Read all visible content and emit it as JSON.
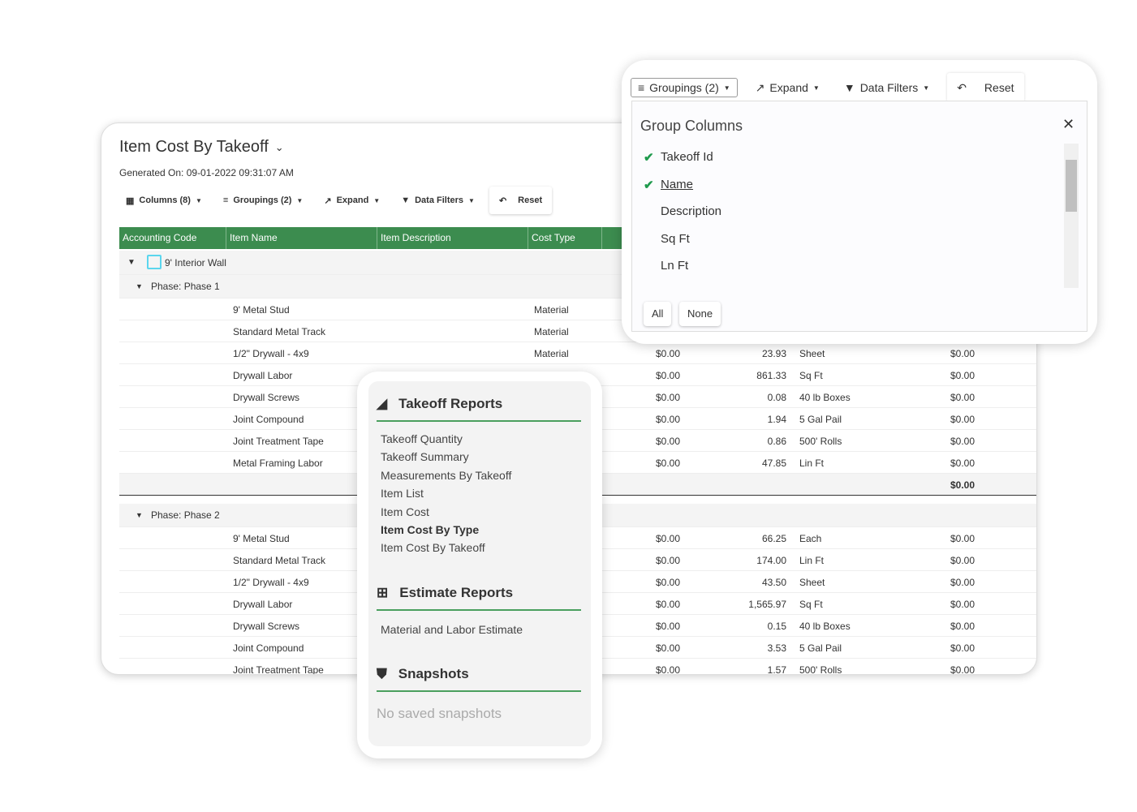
{
  "report": {
    "title": "Item Cost By Takeoff",
    "generated": "Generated On: 09-01-2022 09:31:07 AM",
    "toolbar": {
      "columns": "Columns (8)",
      "groupings": "Groupings (2)",
      "expand": "Expand",
      "filters": "Data Filters",
      "reset": "Reset"
    },
    "headers": [
      "Accounting Code",
      "Item Name",
      "Item Description",
      "Cost Type"
    ],
    "group": "9' Interior Wall",
    "phases": [
      {
        "label": "Phase: Phase 1",
        "subtotal": "$0.00",
        "rows": [
          {
            "name": "9' Metal Stud",
            "type": "Material",
            "cost": "",
            "qty": "",
            "unit": "",
            "total": ""
          },
          {
            "name": "Standard Metal Track",
            "type": "Material",
            "cost": "",
            "qty": "",
            "unit": "",
            "total": ""
          },
          {
            "name": "1/2\" Drywall - 4x9",
            "type": "Material",
            "cost": "$0.00",
            "qty": "23.93",
            "unit": "Sheet",
            "total": "$0.00"
          },
          {
            "name": "Drywall Labor",
            "type": "",
            "cost": "$0.00",
            "qty": "861.33",
            "unit": "Sq Ft",
            "total": "$0.00"
          },
          {
            "name": "Drywall Screws",
            "type": "",
            "cost": "$0.00",
            "qty": "0.08",
            "unit": "40 lb Boxes",
            "total": "$0.00"
          },
          {
            "name": "Joint Compound",
            "type": "",
            "cost": "$0.00",
            "qty": "1.94",
            "unit": "5 Gal Pail",
            "total": "$0.00"
          },
          {
            "name": "Joint Treatment Tape",
            "type": "",
            "cost": "$0.00",
            "qty": "0.86",
            "unit": "500' Rolls",
            "total": "$0.00"
          },
          {
            "name": "Metal Framing Labor",
            "type": "",
            "cost": "$0.00",
            "qty": "47.85",
            "unit": "Lin Ft",
            "total": "$0.00"
          }
        ]
      },
      {
        "label": "Phase: Phase 2",
        "rows": [
          {
            "name": "9' Metal Stud",
            "type": "",
            "cost": "$0.00",
            "qty": "66.25",
            "unit": "Each",
            "total": "$0.00"
          },
          {
            "name": "Standard Metal Track",
            "type": "",
            "cost": "$0.00",
            "qty": "174.00",
            "unit": "Lin Ft",
            "total": "$0.00"
          },
          {
            "name": "1/2\" Drywall - 4x9",
            "type": "",
            "cost": "$0.00",
            "qty": "43.50",
            "unit": "Sheet",
            "total": "$0.00"
          },
          {
            "name": "Drywall Labor",
            "type": "",
            "cost": "$0.00",
            "qty": "1,565.97",
            "unit": "Sq Ft",
            "total": "$0.00"
          },
          {
            "name": "Drywall Screws",
            "type": "",
            "cost": "$0.00",
            "qty": "0.15",
            "unit": "40 lb Boxes",
            "total": "$0.00"
          },
          {
            "name": "Joint Compound",
            "type": "",
            "cost": "$0.00",
            "qty": "3.53",
            "unit": "5 Gal Pail",
            "total": "$0.00"
          },
          {
            "name": "Joint Treatment Tape",
            "type": "",
            "cost": "$0.00",
            "qty": "1.57",
            "unit": "500' Rolls",
            "total": "$0.00"
          }
        ]
      }
    ]
  },
  "groupings": {
    "toolbar": {
      "groupings": "Groupings (2)",
      "expand": "Expand",
      "filters": "Data Filters",
      "reset": "Reset"
    },
    "title": "Group Columns",
    "items": [
      {
        "label": "Takeoff Id",
        "checked": true
      },
      {
        "label": "Name",
        "checked": true
      },
      {
        "label": "Description",
        "checked": false
      },
      {
        "label": "Sq Ft",
        "checked": false
      },
      {
        "label": "Ln Ft",
        "checked": false
      }
    ],
    "all": "All",
    "none": "None"
  },
  "reports": {
    "takeoff": {
      "title": "Takeoff Reports",
      "items": [
        "Takeoff Quantity",
        "Takeoff Summary",
        "Measurements By Takeoff",
        "Item List",
        "Item Cost",
        "Item Cost By Type",
        "Item Cost By Takeoff"
      ],
      "active": "Item Cost By Type"
    },
    "estimate": {
      "title": "Estimate Reports",
      "items": [
        "Material and Labor Estimate"
      ]
    },
    "snapshots": {
      "title": "Snapshots",
      "empty": "No saved snapshots"
    }
  },
  "colors": {
    "accent": "#3c8c4f",
    "check": "#1f9a4d"
  }
}
